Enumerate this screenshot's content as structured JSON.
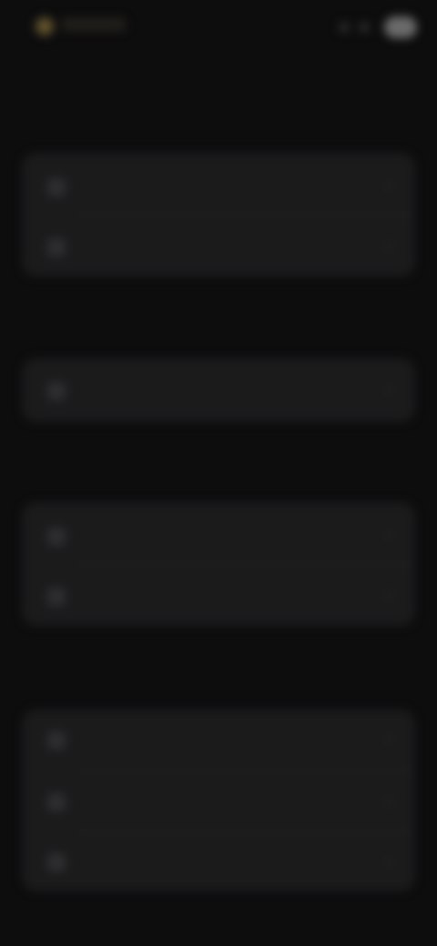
{
  "app": {
    "logo_icon": "app-logo-icon"
  },
  "header": {
    "title": ""
  },
  "sections": [
    {
      "title": "",
      "items": [
        {
          "label": "",
          "icon": "settings-icon"
        },
        {
          "label": "",
          "icon": "settings-icon"
        }
      ]
    },
    {
      "title": "",
      "items": [
        {
          "label": "",
          "icon": "settings-icon"
        }
      ]
    },
    {
      "title": "",
      "items": [
        {
          "label": "",
          "icon": "settings-icon"
        },
        {
          "label": "",
          "icon": "settings-icon"
        }
      ]
    },
    {
      "title": "",
      "items": [
        {
          "label": "",
          "icon": "settings-icon"
        },
        {
          "label": "",
          "icon": "settings-icon"
        },
        {
          "label": "",
          "icon": "settings-icon"
        }
      ]
    }
  ],
  "colors": {
    "background": "#0d0d0e",
    "card": "#1b1b1c",
    "accent": "#7a6533"
  }
}
